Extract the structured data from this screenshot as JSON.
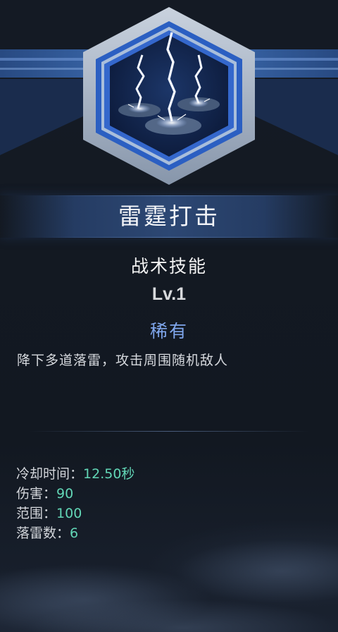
{
  "skill": {
    "name": "雷霆打击",
    "type": "战术技能",
    "level": "Lv.1",
    "rarity": "稀有",
    "description": "降下多道落雷，攻击周围随机敌人",
    "icon": "lightning-strike-icon"
  },
  "stats": [
    {
      "label": "冷却时间",
      "separator": "：",
      "value": "12.50秒"
    },
    {
      "label": "伤害",
      "separator": "：",
      "value": "90"
    },
    {
      "label": "范围",
      "separator": "：",
      "value": "100"
    },
    {
      "label": "落雷数",
      "separator": "：",
      "value": "6"
    }
  ],
  "colors": {
    "background": "#131922",
    "title_banner": "#2e4a78",
    "rarity": "#7fa6ec",
    "stat_value": "#62d6b6",
    "text": "#d6d9de"
  }
}
